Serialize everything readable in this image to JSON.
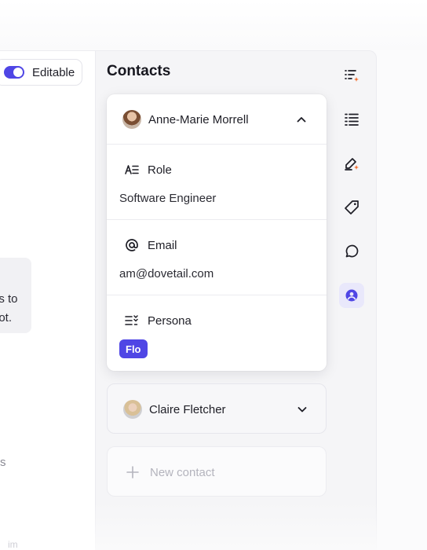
{
  "left": {
    "toggle_label": "Editable",
    "message_line_1": "ns to",
    "message_line_2": "hot.",
    "fragment_s": "s",
    "fragment_bottom": "im"
  },
  "panel": {
    "title": "Contacts",
    "expanded_contact": {
      "name": "Anne-Marie Morrell",
      "fields": [
        {
          "label": "Role",
          "value": "Software Engineer",
          "icon": "role-icon"
        },
        {
          "label": "Email",
          "value": "am@dovetail.com",
          "icon": "at-icon"
        },
        {
          "label": "Persona",
          "value": "Flo",
          "icon": "persona-icon"
        }
      ]
    },
    "collapsed_contact": {
      "name": "Claire Fletcher"
    },
    "new_contact_label": "New contact"
  },
  "rail": {
    "items": [
      {
        "name": "ai-list-icon"
      },
      {
        "name": "list-icon"
      },
      {
        "name": "ai-highlight-icon"
      },
      {
        "name": "tag-icon"
      },
      {
        "name": "comment-icon"
      },
      {
        "name": "contacts-icon",
        "active": true
      }
    ]
  },
  "colors": {
    "accent": "#4f46e5",
    "ai_spark": "#f26b2a",
    "active_rail_bg": "#e9e8fb"
  }
}
